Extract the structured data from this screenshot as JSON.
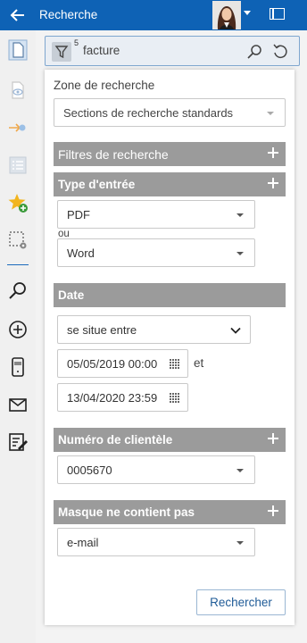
{
  "header": {
    "title": "Recherche",
    "back_icon": "arrow-left-icon",
    "window_icon": "window-toggle-icon"
  },
  "rail": {
    "icons": [
      "document-icon",
      "preview-icon",
      "workflow-icon",
      "list-icon",
      "favorite-add-icon",
      "selection-settings-icon",
      "search-icon",
      "add-icon",
      "barcode-scanner-icon",
      "mail-icon",
      "edit-list-icon"
    ]
  },
  "search": {
    "filter_count": "5",
    "query": "facture"
  },
  "panel": {
    "zone_label": "Zone de recherche",
    "zone_value": "Sections de recherche standards",
    "filters_header": "Filtres de recherche",
    "type_header": "Type d'entrée",
    "type_value_1": "PDF",
    "or_label": "ou",
    "type_value_2": "Word",
    "date_header": "Date",
    "date_operator": "se situe entre",
    "date_from": "05/05/2019 00:00",
    "and_label": "et",
    "date_to": "13/04/2020 23:59",
    "client_header": "Numéro de clientèle",
    "client_value": "0005670",
    "mask_header": "Masque ne contient pas",
    "mask_value": "e-mail",
    "submit_label": "Rechercher"
  },
  "colors": {
    "titlebar": "#0e62b5",
    "section_header": "#9b9b9b",
    "accent": "#1f5b97"
  }
}
